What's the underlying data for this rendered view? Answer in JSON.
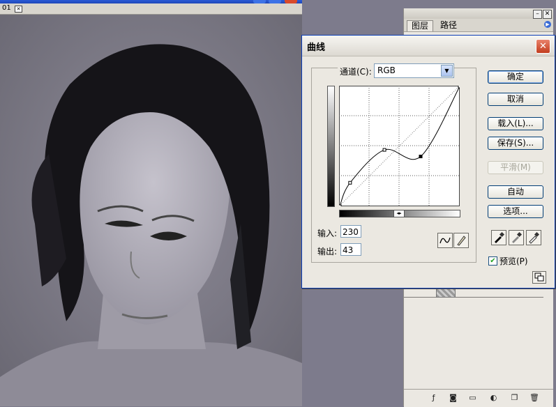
{
  "document": {
    "tab_label": "01",
    "tab_icon": "close-icon"
  },
  "layers_palette": {
    "tabs": [
      "图层",
      "路径"
    ],
    "footer_icons": [
      "link-icon",
      "fx-icon",
      "mask-icon",
      "folder-icon",
      "adjustment-icon",
      "new-layer-icon",
      "trash-icon"
    ]
  },
  "curves": {
    "title": "曲线",
    "channel_label": "通道(C):",
    "channel_value": "RGB",
    "input_label": "输入:",
    "input_value": "230",
    "output_label": "输出:",
    "output_value": "43",
    "buttons": {
      "ok": "确定",
      "cancel": "取消",
      "load": "载入(L)...",
      "save": "保存(S)...",
      "smooth": "平滑(M)",
      "auto": "自动",
      "options": "选项..."
    },
    "preview_label": "预览(P)",
    "preview_checked": true,
    "tools": [
      "curve-point-tool-icon",
      "pencil-tool-icon"
    ],
    "eyedroppers": [
      "black-eyedropper-icon",
      "gray-eyedropper-icon",
      "white-eyedropper-icon"
    ],
    "curve_points": [
      [
        0,
        0
      ],
      [
        22,
        50
      ],
      [
        95,
        120
      ],
      [
        172,
        106
      ],
      [
        255,
        255
      ]
    ]
  }
}
